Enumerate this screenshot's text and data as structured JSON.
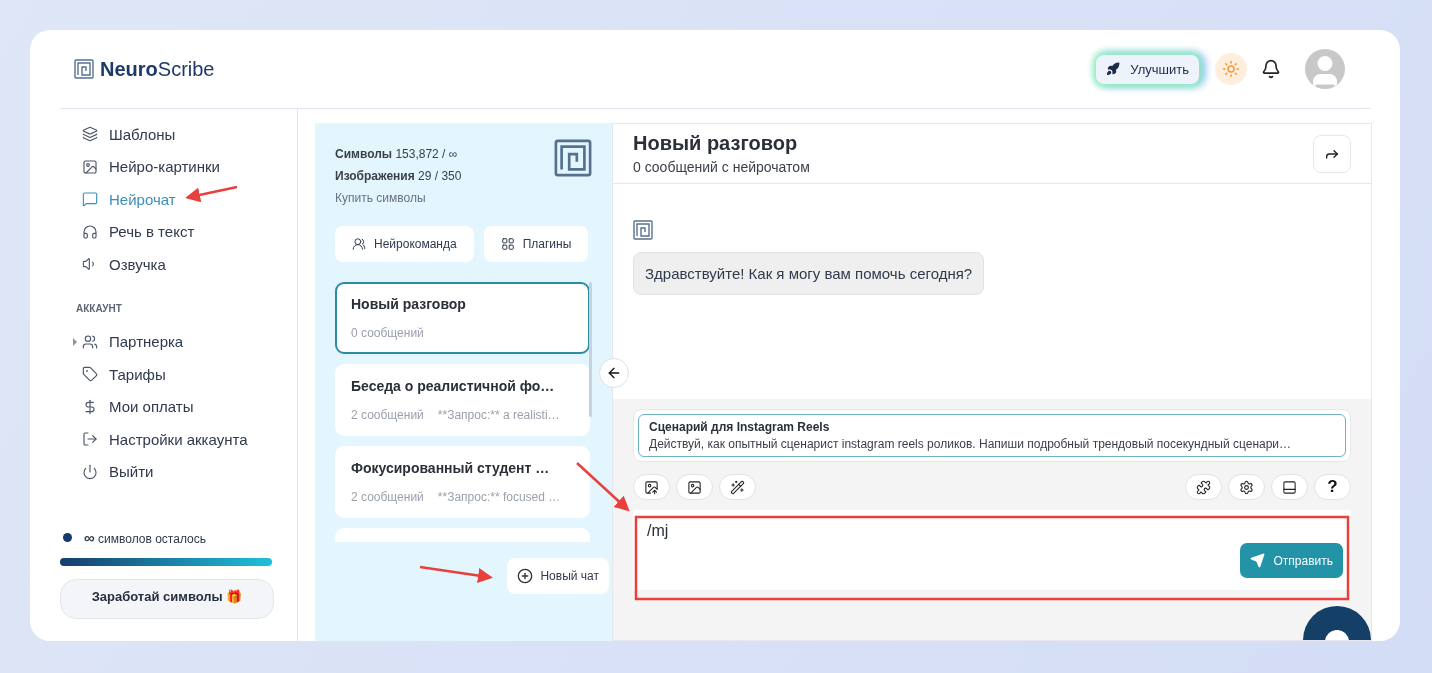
{
  "header": {
    "logo": "**Neuro**Scribe",
    "upgrade_button": "Улучшить"
  },
  "sidebar": {
    "nav_items": [
      {
        "label": "Шаблоны",
        "selected": false
      },
      {
        "label": "Нейро-картинки",
        "selected": false
      },
      {
        "label": "Нейрочат",
        "selected": true
      },
      {
        "label": "Речь в текст",
        "selected": false
      },
      {
        "label": "Озвучка",
        "selected": false
      }
    ],
    "account_label": "АККАУНТ",
    "account_items": [
      {
        "label": "Партнерка",
        "expanded": false
      },
      {
        "label": "Тарифы"
      },
      {
        "label": "Мои оплаты"
      },
      {
        "label": "Настройки аккаунта"
      },
      {
        "label": "Выйти"
      }
    ],
    "credits": {
      "amount": "∞",
      "label": "символов осталось",
      "level": 1
    },
    "earn_button": "Заработай символы 🎁"
  },
  "chat_list": {
    "stats": [
      {
        "label": "Символы",
        "value": "153,872 / ∞"
      },
      {
        "label": "Изображения",
        "value": "29 / 350"
      }
    ],
    "buy_link": "Купить символы",
    "buttons": [
      "Нейрокоманда",
      "Плагины"
    ],
    "chats": [
      {
        "title": "Новый разговор",
        "count": "0 сообщений",
        "selected": true
      },
      {
        "title": "Беседа о реалистичной фо…",
        "count": "2 сообщений",
        "preview": "**Запрос:** a realisti…",
        "selected": false
      },
      {
        "title": "Фокусированный студент …",
        "count": "2 сообщений",
        "preview": "**Запрос:** focused …",
        "selected": false
      }
    ],
    "more_below": true,
    "new_chat_button": "Новый чат"
  },
  "conversation": {
    "title": "Новый разговор",
    "subtitle": "0 сообщений с нейрочатом",
    "messages": [
      {
        "text": "Здравствуйте! Как я могу вам помочь сегодня?"
      }
    ],
    "template": {
      "title": "Сценарий для Instagram Reels",
      "text": "Действуй, как опытный сценарист instagram reels роликов. Напиши подробный трендовый посекундный сценари…"
    },
    "help_button": "?",
    "input": {
      "value": "/mj"
    },
    "send_button": "Отправить"
  }
}
